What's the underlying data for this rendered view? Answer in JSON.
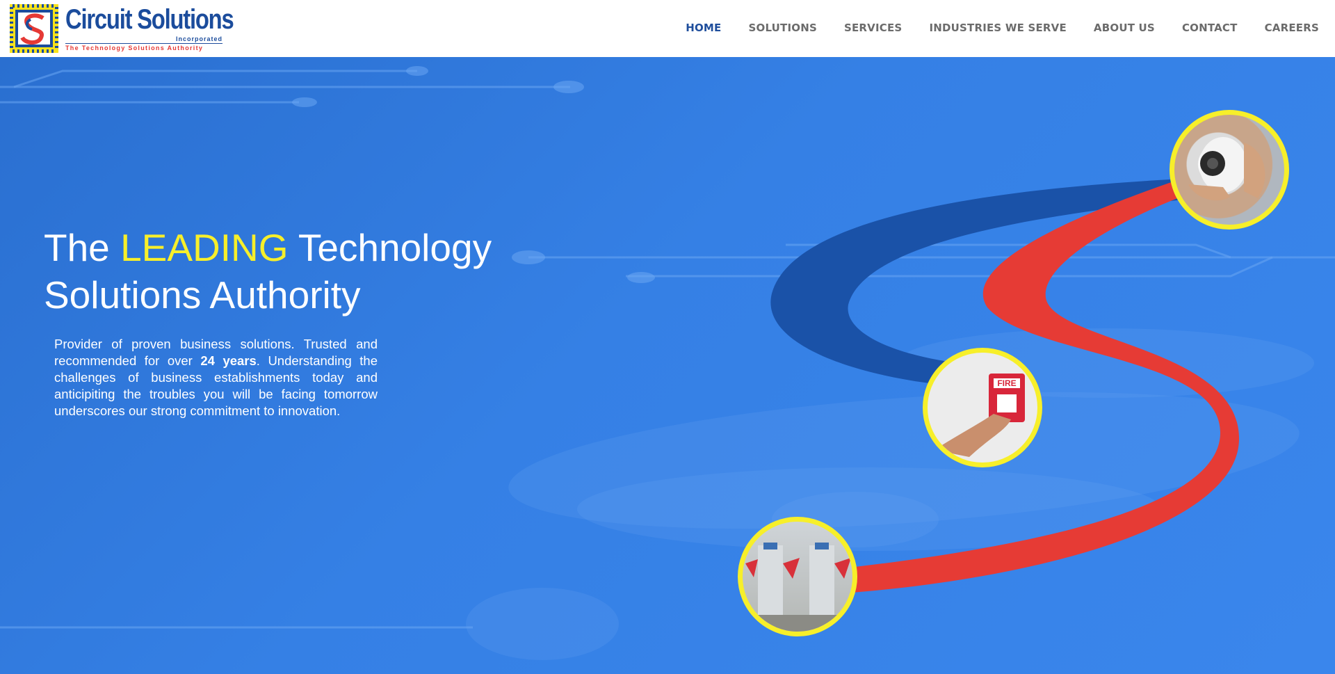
{
  "brand": {
    "name": "Circuit Solutions",
    "suffix": "Incorporated",
    "tagline": "The Technology Solutions Authority"
  },
  "nav": {
    "items": [
      {
        "label": "HOME",
        "active": true
      },
      {
        "label": "SOLUTIONS",
        "active": false
      },
      {
        "label": "SERVICES",
        "active": false
      },
      {
        "label": "INDUSTRIES WE SERVE",
        "active": false
      },
      {
        "label": "ABOUT US",
        "active": false
      },
      {
        "label": "CONTACT",
        "active": false
      },
      {
        "label": "CAREERS",
        "active": false
      }
    ]
  },
  "hero": {
    "headline_pre": "The ",
    "headline_highlight": "LEADING",
    "headline_post": " Technology Solutions Authority",
    "para_1": "Provider of proven business solutions. Trusted and recommended for over ",
    "para_bold": "24 years",
    "para_2": ". Understanding the challenges of business establishments today and anticipiting the troubles you will be facing tomorrow underscores our strong commitment to innovation.",
    "images": [
      "security-camera-photo",
      "fire-alarm-photo",
      "turnstile-gates-photo"
    ]
  },
  "colors": {
    "hero_blue": "#3580e5",
    "s_dark_blue": "#1a52a8",
    "s_red": "#e63b35",
    "ring_yellow": "#f7ef2a",
    "nav_active": "#1f4e9c",
    "nav_default": "#6b6b6b"
  }
}
